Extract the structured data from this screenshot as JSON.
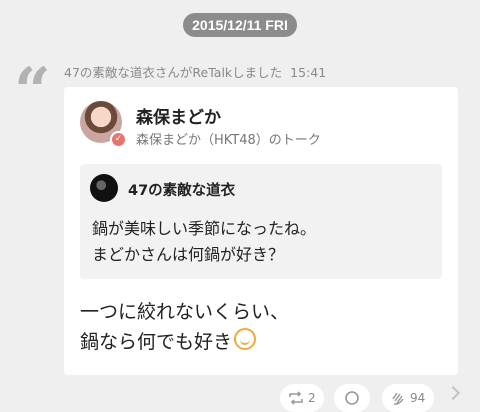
{
  "header": {
    "date": "2015/12/11 FRI"
  },
  "retalk": {
    "text": "47の素敵な道衣さんがReTalkしました",
    "time": "15:41"
  },
  "post": {
    "author_name": "森保まどか",
    "author_sub": "森保まどか（HKT48）のトーク",
    "quoted": {
      "author": "47の素敵な道衣",
      "line1": "鍋が美味しい季節になったね。",
      "line2": "まどかさんは何鍋が好き？"
    },
    "reply_line1": "一つに絞れないくらい、",
    "reply_line2": "鍋なら何でも好き"
  },
  "actions": {
    "retalk_count": "2",
    "like_count": "94"
  },
  "colors": {
    "accent": "#e9736f",
    "pill": "#8c8c8c",
    "background": "#efefef"
  },
  "icons": [
    "quote-icon",
    "retalk-icon",
    "comment-icon",
    "clap-icon",
    "chevron-right-icon"
  ]
}
